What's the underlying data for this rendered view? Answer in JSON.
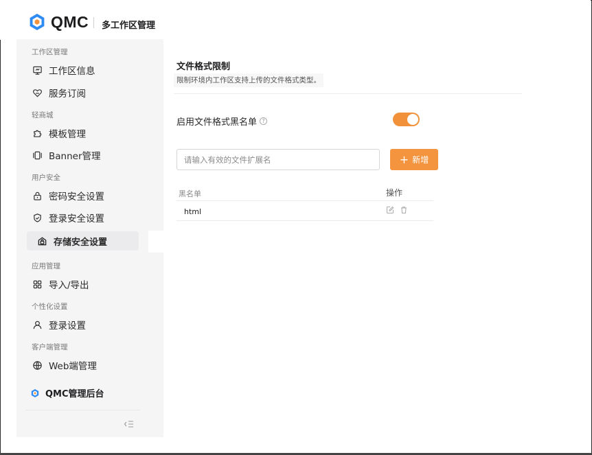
{
  "app": {
    "logo_text": "QMC",
    "title": "多工作区管理"
  },
  "sidebar": {
    "groups": [
      {
        "label": "工作区管理"
      },
      {
        "label": "轻商城"
      },
      {
        "label": "用户安全"
      },
      {
        "label": "应用管理"
      },
      {
        "label": "个性化设置"
      },
      {
        "label": "客户端管理"
      }
    ],
    "items": [
      {
        "label": "工作区信息",
        "icon": "monitor-icon"
      },
      {
        "label": "服务订阅",
        "icon": "heart-icon"
      },
      {
        "label": "模板管理",
        "icon": "puzzle-icon"
      },
      {
        "label": "Banner管理",
        "icon": "banner-icon"
      },
      {
        "label": "密码安全设置",
        "icon": "lock-icon"
      },
      {
        "label": "登录安全设置",
        "icon": "shield-icon"
      },
      {
        "label": "存储安全设置",
        "icon": "storage-lock-icon",
        "active": true
      },
      {
        "label": "导入/导出",
        "icon": "grid-icon"
      },
      {
        "label": "登录设置",
        "icon": "user-icon"
      },
      {
        "label": "Web端管理",
        "icon": "globe-icon"
      }
    ],
    "admin_label": "QMC管理后台",
    "collapse_icon": "collapse-icon"
  },
  "main": {
    "section_title": "文件格式限制",
    "section_desc": "限制环境内工作区支持上传的文件格式类型。",
    "toggle_label": "启用文件格式黑名单",
    "toggle_on": true,
    "input_placeholder": "请输入有效的文件扩展名",
    "input_value": "",
    "add_button_label": "新增",
    "table": {
      "headers": [
        "黑名单",
        "操作"
      ],
      "rows": [
        {
          "name": "html"
        }
      ]
    }
  },
  "colors": {
    "accent": "#f5943f",
    "toggle": "#f1923a",
    "logo_blue": "#2f8cf2",
    "logo_orange": "#f5943f"
  }
}
